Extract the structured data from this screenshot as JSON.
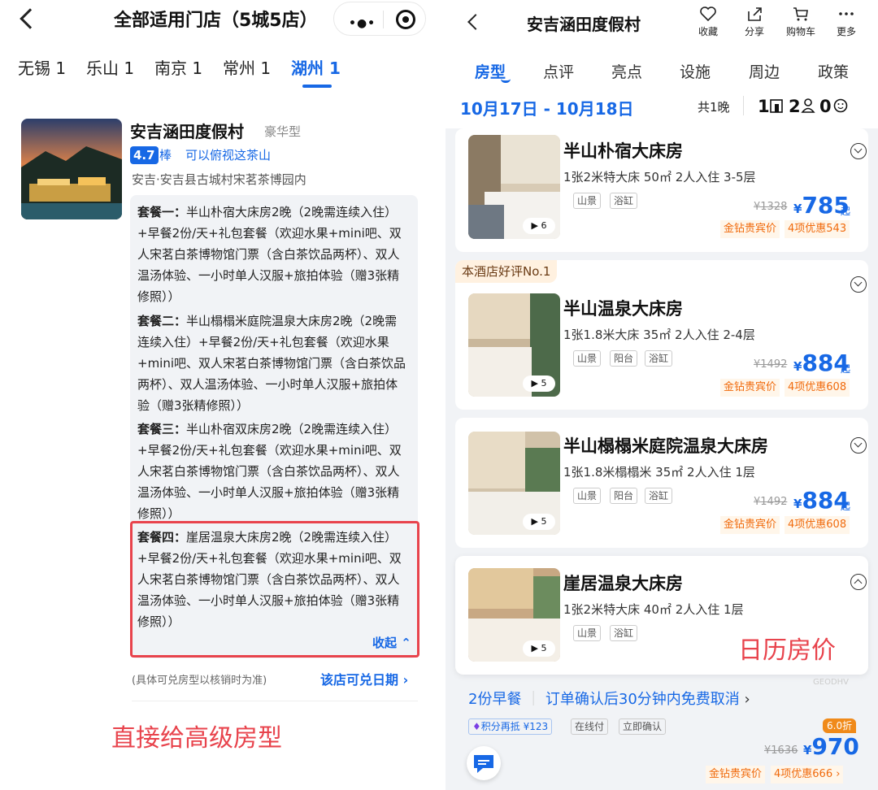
{
  "left": {
    "title": "全部适用门店（5城5店）",
    "cities": [
      "无锡 1",
      "乐山 1",
      "南京 1",
      "常州 1",
      "湖州 1"
    ],
    "active_city": "湖州 1",
    "hotel": {
      "name": "安吉涵田度假村",
      "type": "豪华型",
      "rating": "4.7",
      "rating_word": "棒",
      "feature": "可以俯视这茶山",
      "address": "安吉·安吉县古城村宋茗茶博园内"
    },
    "packages": [
      {
        "label": "套餐一：",
        "text": "半山朴宿大床房2晚（2晚需连续入住）+早餐2份/天+礼包套餐（欢迎水果+mini吧、双人宋茗白茶博物馆门票（含白茶饮品两杯）、双人温汤体验、一小时单人汉服+旅拍体验（赠3张精修照））"
      },
      {
        "label": "套餐二：",
        "text": "半山榻榻米庭院温泉大床房2晚（2晚需连续入住）+早餐2份/天+礼包套餐（欢迎水果+mini吧、双人宋茗白茶博物馆门票（含白茶饮品两杯）、双人温汤体验、一小时单人汉服+旅拍体验（赠3张精修照））"
      },
      {
        "label": "套餐三：",
        "text": "半山朴宿双床房2晚（2晚需连续入住）+早餐2份/天+礼包套餐（欢迎水果+mini吧、双人宋茗白茶博物馆门票（含白茶饮品两杯）、双人温汤体验、一小时单人汉服+旅拍体验（赠3张精修照））"
      },
      {
        "label": "套餐四：",
        "text": "崖居温泉大床房2晚（2晚需连续入住）+早餐2份/天+礼包套餐（欢迎水果+mini吧、双人宋茗白茶博物馆门票（含白茶饮品两杯）、双人温汤体验、一小时单人汉服+旅拍体验（赠3张精修照））"
      }
    ],
    "collapse_label": "收起",
    "note": "(具体可兑房型以核销时为准)",
    "date_link": "该店可兑日期",
    "annotation": "直接给高级房型"
  },
  "right": {
    "title": "安吉涵田度假村",
    "toolbar": {
      "favorite": "收藏",
      "share": "分享",
      "cart": "购物车",
      "more": "更多"
    },
    "tabs": [
      "房型",
      "点评",
      "亮点",
      "设施",
      "周边",
      "政策"
    ],
    "active_tab": "房型",
    "date_range": "10月17日 - 10月18日",
    "nights": "共1晚",
    "guests": "1 2 0",
    "rooms": [
      {
        "name": "半山朴宿大床房",
        "spec": "1张2米特大床 50㎡ 2人入住 3-5层",
        "tags": [
          "山景",
          "浴缸"
        ],
        "orig": "¥1328",
        "price": "785",
        "member": "金钻贵宾价",
        "promo": "4项优惠543",
        "photos": "6"
      },
      {
        "name": "半山温泉大床房",
        "spec": "1张1.8米大床 35㎡ 2人入住 2-4层",
        "tags": [
          "山景",
          "阳台",
          "浴缸"
        ],
        "orig": "¥1492",
        "price": "884",
        "member": "金钻贵宾价",
        "promo": "4项优惠608",
        "photos": "5"
      },
      {
        "name": "半山榻榻米庭院温泉大床房",
        "spec": "1张1.8米榻榻米 35㎡ 2人入住 1层",
        "tags": [
          "山景",
          "阳台",
          "浴缸"
        ],
        "orig": "¥1492",
        "price": "884",
        "member": "金钻贵宾价",
        "promo": "4项优惠608",
        "photos": "5"
      },
      {
        "name": "崖居温泉大床房",
        "spec": "1张2米特大床 40㎡ 2人入住 1层",
        "tags": [
          "山景",
          "浴缸"
        ],
        "photos": "5"
      }
    ],
    "best_badge": "本酒店好评No.1",
    "annotation": "日历房价",
    "watermark": "GEODHV",
    "offer": {
      "breakfast": "2份早餐",
      "cancel": "订单确认后30分钟内免费取消",
      "points": "积分再抵 ¥123",
      "pay": "在线付",
      "confirm": "立即确认",
      "discount": "6.0折",
      "orig": "¥1636",
      "price": "970",
      "member": "金钻贵宾价",
      "promo": "4项优惠666"
    },
    "colors": {
      "accent": "#1768e5",
      "annotation": "#e8434c",
      "promo": "#f06a0c"
    }
  }
}
